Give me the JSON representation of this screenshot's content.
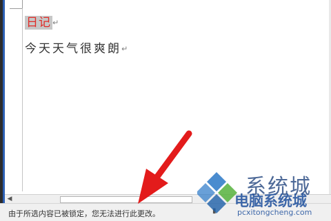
{
  "document": {
    "title_text": "日记",
    "body_text": "今天天气很爽朗",
    "paragraph_mark": "↵"
  },
  "statusbar": {
    "message": "由于所选内容已被锁定，您无法进行此更改。"
  },
  "colors": {
    "selected_text": "#e02a26",
    "selection_bg": "#c7c7c7",
    "arrow": "#e31b1b"
  },
  "watermark": {
    "title": "系统城",
    "subtitle": "电脑系统城",
    "url": "pcxitongcheng.com"
  }
}
